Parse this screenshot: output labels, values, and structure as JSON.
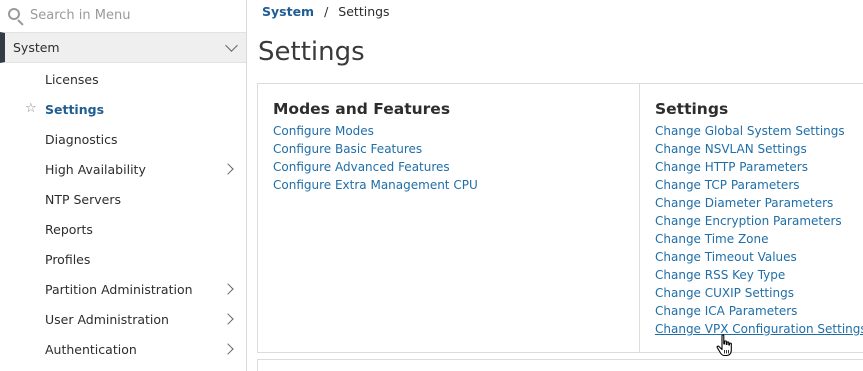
{
  "sidebar": {
    "search_placeholder": "Search in Menu",
    "section_label": "System",
    "items": [
      {
        "label": "Licenses",
        "active": false,
        "expandable": false
      },
      {
        "label": "Settings",
        "active": true,
        "expandable": false
      },
      {
        "label": "Diagnostics",
        "active": false,
        "expandable": false
      },
      {
        "label": "High Availability",
        "active": false,
        "expandable": true
      },
      {
        "label": "NTP Servers",
        "active": false,
        "expandable": false
      },
      {
        "label": "Reports",
        "active": false,
        "expandable": false
      },
      {
        "label": "Profiles",
        "active": false,
        "expandable": false
      },
      {
        "label": "Partition Administration",
        "active": false,
        "expandable": true
      },
      {
        "label": "User Administration",
        "active": false,
        "expandable": true
      },
      {
        "label": "Authentication",
        "active": false,
        "expandable": true
      }
    ]
  },
  "breadcrumb": {
    "parent": "System",
    "separator": "/",
    "current": "Settings"
  },
  "page_title": "Settings",
  "modes_features": {
    "heading": "Modes and Features",
    "links": [
      "Configure Modes",
      "Configure Basic Features",
      "Configure Advanced Features",
      "Configure Extra Management CPU"
    ]
  },
  "settings": {
    "heading": "Settings",
    "links": [
      "Change Global System Settings",
      "Change NSVLAN Settings",
      "Change HTTP Parameters",
      "Change TCP Parameters",
      "Change Diameter Parameters",
      "Change Encryption Parameters",
      "Change Time Zone",
      "Change Timeout Values",
      "Change RSS Key Type",
      "Change CUXIP Settings",
      "Change ICA Parameters",
      "Change VPX Configuration Settings"
    ]
  },
  "colors": {
    "link": "#1f6ea8",
    "active_nav": "#1f5d93",
    "section_bar": "#333b45"
  }
}
